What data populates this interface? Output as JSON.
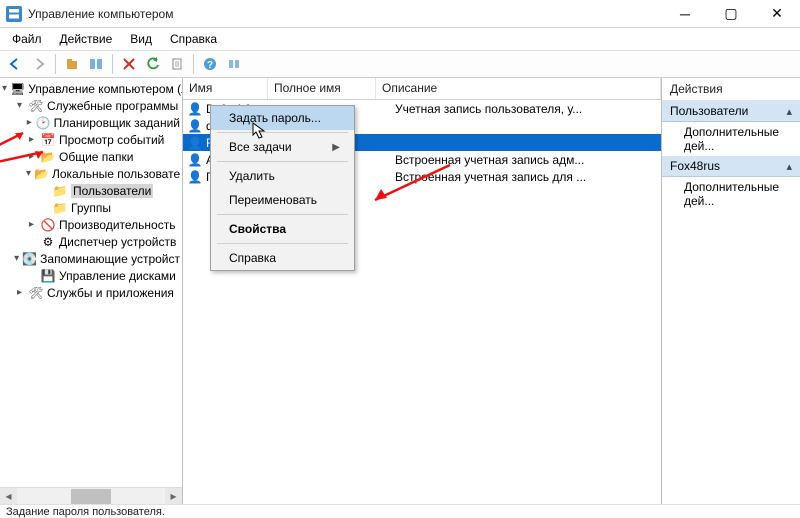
{
  "window": {
    "title": "Управление компьютером"
  },
  "menu": {
    "file": "Файл",
    "action": "Действие",
    "view": "Вид",
    "help": "Справка"
  },
  "tree": {
    "root": "Управление компьютером (л",
    "sys": "Служебные программы",
    "sched": "Планировщик заданий",
    "events": "Просмотр событий",
    "shares": "Общие папки",
    "local": "Локальные пользовате",
    "users": "Пользователи",
    "groups": "Группы",
    "perf": "Производительность",
    "devmgr": "Диспетчер устройств",
    "storage": "Запоминающие устройст",
    "diskmgr": "Управление дисками",
    "services": "Службы и приложения"
  },
  "list": {
    "col_name": "Имя",
    "col_full": "Полное имя",
    "col_desc": "Описание",
    "rows": [
      {
        "name": "DefaultAcco...",
        "full": "",
        "desc": "Учетная запись пользователя, у..."
      },
      {
        "name": "defaultuser0",
        "full": "",
        "desc": ""
      },
      {
        "name": "Fox",
        "full": "",
        "desc": ""
      },
      {
        "name": "Адм",
        "full": "",
        "desc": "Встроенная учетная запись адм..."
      },
      {
        "name": "Гос",
        "full": "",
        "desc": "Встроенная учетная запись для ..."
      }
    ]
  },
  "ctx": {
    "set_pass": "Задать пароль...",
    "all_tasks": "Все задачи",
    "delete": "Удалить",
    "rename": "Переименовать",
    "props": "Свойства",
    "help": "Справка"
  },
  "actions": {
    "title": "Действия",
    "sec1": "Пользователи",
    "sec2": "Fox48rus",
    "more": "Дополнительные дей..."
  },
  "status": "Задание пароля пользователя."
}
